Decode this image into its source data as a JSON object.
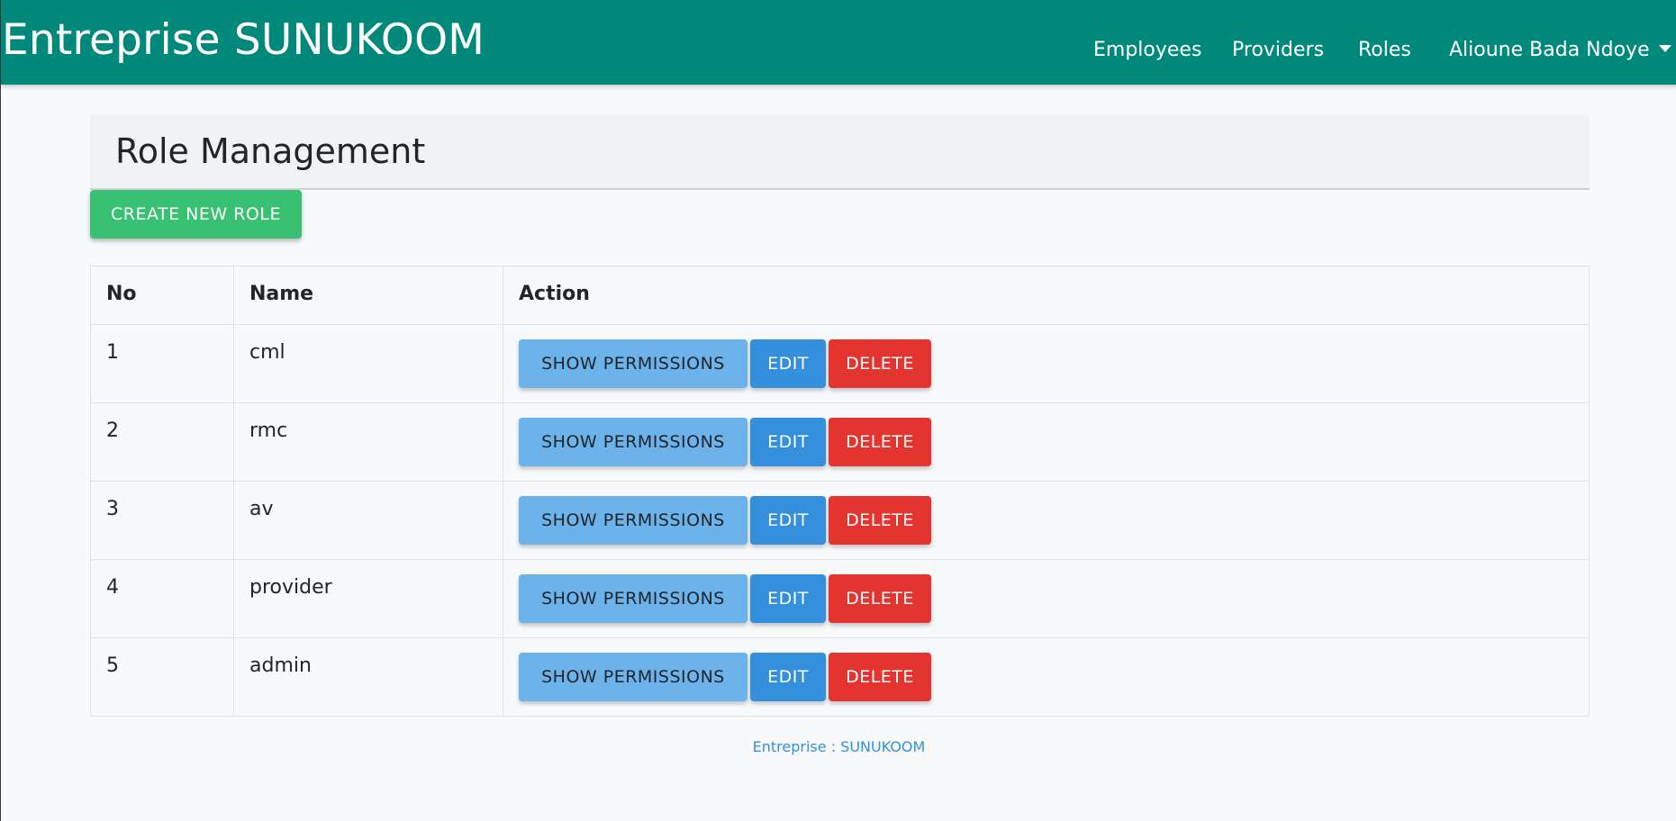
{
  "navbar": {
    "brand": "Entreprise SUNUKOOM",
    "links": [
      "Employees",
      "Providers",
      "Roles"
    ],
    "user": "Alioune Bada Ndoye"
  },
  "header": {
    "title": "Role Management"
  },
  "create_button": "CREATE NEW ROLE",
  "table": {
    "headers": [
      "No",
      "Name",
      "Action"
    ],
    "rows": [
      {
        "no": "1",
        "name": "cml"
      },
      {
        "no": "2",
        "name": "rmc"
      },
      {
        "no": "3",
        "name": "av"
      },
      {
        "no": "4",
        "name": "provider"
      },
      {
        "no": "5",
        "name": "admin"
      }
    ],
    "actions": {
      "show": "SHOW PERMISSIONS",
      "edit": "EDIT",
      "delete": "DELETE"
    }
  },
  "footer": "Entreprise : SUNUKOOM",
  "colors": {
    "navbar": "#00897b",
    "create": "#38c172",
    "show": "#6cb2eb",
    "edit": "#3490dc",
    "delete": "#e3342f"
  }
}
